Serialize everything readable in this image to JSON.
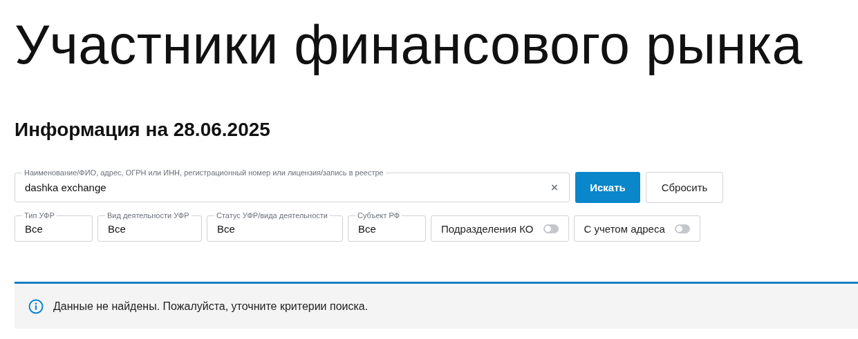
{
  "page": {
    "title": "Участники финансового рынка",
    "subtitle": "Информация на 28.06.2025"
  },
  "search": {
    "label": "Наименование/ФИО, адрес, ОГРН или ИНН, регистрационный номер или лицензия/запись в реестре",
    "value": "dashka exchange",
    "clear": "×"
  },
  "buttons": [
    {
      "label": "Искать",
      "kind": "primary"
    },
    {
      "label": "Сбросить",
      "kind": "secondary"
    }
  ],
  "filters": [
    {
      "kind": "select",
      "label": "Тип УФР",
      "value": "Все"
    },
    {
      "kind": "select",
      "label": "Вид деятельности УФР",
      "value": "Все"
    },
    {
      "kind": "select",
      "label": "Статус УФР/вида деятельности",
      "value": "Все"
    },
    {
      "kind": "select",
      "label": "Субъект РФ",
      "value": "Все"
    },
    {
      "kind": "toggle",
      "label": "Подразделения КО",
      "on": false
    },
    {
      "kind": "toggle",
      "label": "С учетом адреса",
      "on": false
    }
  ],
  "notice": {
    "text": "Данные не найдены. Пожалуйста, уточните критерии поиска."
  }
}
